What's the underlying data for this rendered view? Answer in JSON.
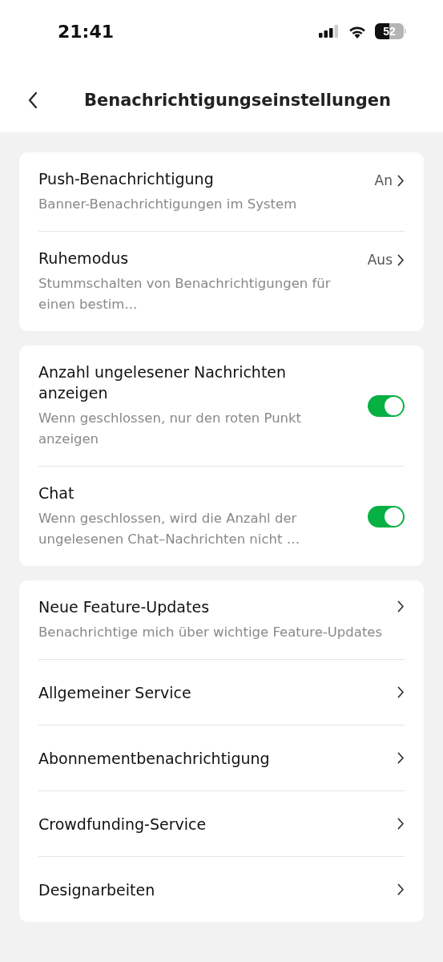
{
  "status_bar": {
    "time": "21:41",
    "battery": "52"
  },
  "header": {
    "title": "Benachrichtigungseinstellungen"
  },
  "sections": [
    {
      "items": [
        {
          "kind": "link",
          "title": "Push-Benachrichtigung",
          "subtitle": "Banner-Benachrichtigungen im System",
          "value": "An"
        },
        {
          "kind": "link",
          "title": "Ruhemodus",
          "subtitle": "Stummschalten von Benachrichtigungen für einen bestim...",
          "value": "Aus"
        }
      ]
    },
    {
      "items": [
        {
          "kind": "toggle",
          "title": "Anzahl ungelesener Nachrichten anzeigen",
          "subtitle": "Wenn geschlossen, nur den roten Punkt anzeigen",
          "on": true
        },
        {
          "kind": "toggle",
          "title": "Chat",
          "subtitle": "Wenn geschlossen, wird die Anzahl der ungelesenen Chat–Nachrichten nicht …",
          "on": true
        }
      ]
    },
    {
      "items": [
        {
          "kind": "link",
          "title": "Neue Feature-Updates",
          "subtitle": "Benachrichtige mich über wichtige Feature-Updates"
        },
        {
          "kind": "link",
          "title": "Allgemeiner Service"
        },
        {
          "kind": "link",
          "title": "Abonnementbenachrichtigung"
        },
        {
          "kind": "link",
          "title": "Crowdfunding-Service"
        },
        {
          "kind": "link",
          "title": "Designarbeiten"
        }
      ]
    }
  ]
}
